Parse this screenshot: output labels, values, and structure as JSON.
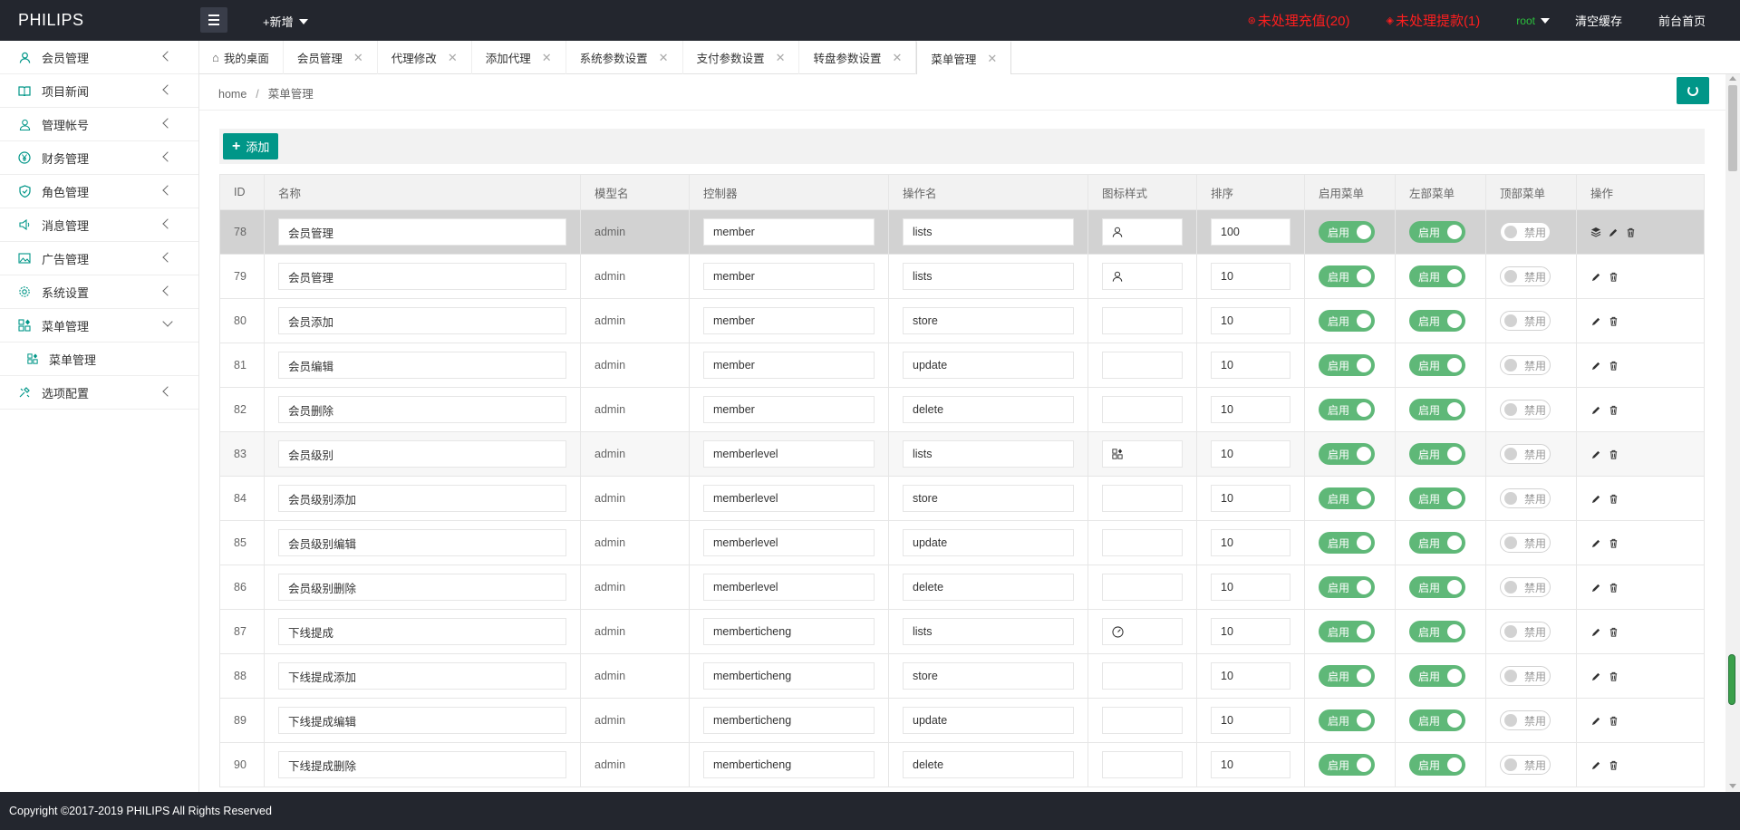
{
  "brand": "PHILIPS",
  "topbar": {
    "add_new": "+新增",
    "pending_recharge": "未处理充值(20)",
    "pending_withdraw": "未处理提款(1)",
    "user": "root",
    "clear_cache": "清空缓存",
    "front_home": "前台首页"
  },
  "sidebar": {
    "items": [
      {
        "label": "会员管理",
        "icon": "user-icon"
      },
      {
        "label": "项目新闻",
        "icon": "book-icon"
      },
      {
        "label": "管理帐号",
        "icon": "user-outline-icon"
      },
      {
        "label": "财务管理",
        "icon": "yen-icon"
      },
      {
        "label": "角色管理",
        "icon": "shield-icon"
      },
      {
        "label": "消息管理",
        "icon": "speaker-icon"
      },
      {
        "label": "广告管理",
        "icon": "image-icon"
      },
      {
        "label": "系统设置",
        "icon": "gear-icon"
      },
      {
        "label": "菜单管理",
        "icon": "apps-icon"
      },
      {
        "label": "选项配置",
        "icon": "tools-icon"
      }
    ],
    "sub_item": "菜单管理"
  },
  "tabs": [
    {
      "label": "我的桌面"
    },
    {
      "label": "会员管理"
    },
    {
      "label": "代理修改"
    },
    {
      "label": "添加代理"
    },
    {
      "label": "系统参数设置"
    },
    {
      "label": "支付参数设置"
    },
    {
      "label": "转盘参数设置"
    },
    {
      "label": "菜单管理"
    }
  ],
  "breadcrumb": {
    "home": "home",
    "sep": "/",
    "current": "菜单管理"
  },
  "add_button": "添加",
  "table": {
    "headers": {
      "id": "ID",
      "name": "名称",
      "model": "模型名",
      "controller": "控制器",
      "action": "操作名",
      "icon": "图标样式",
      "sort": "排序",
      "enable": "启用菜单",
      "left": "左部菜单",
      "top": "顶部菜单",
      "ops": "操作"
    },
    "on_label": "启用",
    "off_label": "禁用",
    "rows": [
      {
        "id": "78",
        "name": "会员管理",
        "model": "admin",
        "controller": "member",
        "action": "lists",
        "icon": "user-icon",
        "sort": "100"
      },
      {
        "id": "79",
        "name": "会员管理",
        "model": "admin",
        "controller": "member",
        "action": "lists",
        "icon": "user-icon",
        "sort": "10"
      },
      {
        "id": "80",
        "name": "会员添加",
        "model": "admin",
        "controller": "member",
        "action": "store",
        "icon": "",
        "sort": "10"
      },
      {
        "id": "81",
        "name": "会员编辑",
        "model": "admin",
        "controller": "member",
        "action": "update",
        "icon": "",
        "sort": "10"
      },
      {
        "id": "82",
        "name": "会员删除",
        "model": "admin",
        "controller": "member",
        "action": "delete",
        "icon": "",
        "sort": "10"
      },
      {
        "id": "83",
        "name": "会员级别",
        "model": "admin",
        "controller": "memberlevel",
        "action": "lists",
        "icon": "apps-icon",
        "sort": "10"
      },
      {
        "id": "84",
        "name": "会员级别添加",
        "model": "admin",
        "controller": "memberlevel",
        "action": "store",
        "icon": "",
        "sort": "10"
      },
      {
        "id": "85",
        "name": "会员级别编辑",
        "model": "admin",
        "controller": "memberlevel",
        "action": "update",
        "icon": "",
        "sort": "10"
      },
      {
        "id": "86",
        "name": "会员级别删除",
        "model": "admin",
        "controller": "memberlevel",
        "action": "delete",
        "icon": "",
        "sort": "10"
      },
      {
        "id": "87",
        "name": "下线提成",
        "model": "admin",
        "controller": "memberticheng",
        "action": "lists",
        "icon": "gauge-icon",
        "sort": "10"
      },
      {
        "id": "88",
        "name": "下线提成添加",
        "model": "admin",
        "controller": "memberticheng",
        "action": "store",
        "icon": "",
        "sort": "10"
      },
      {
        "id": "89",
        "name": "下线提成编辑",
        "model": "admin",
        "controller": "memberticheng",
        "action": "update",
        "icon": "",
        "sort": "10"
      },
      {
        "id": "90",
        "name": "下线提成删除",
        "model": "admin",
        "controller": "memberticheng",
        "action": "delete",
        "icon": "",
        "sort": "10"
      }
    ]
  },
  "footer": "Copyright ©2017-2019 PHILIPS All Rights Reserved",
  "colors": {
    "accent": "#009688",
    "switch_on": "#5fb878",
    "alert": "#ff1e1e",
    "topbar": "#23262e"
  }
}
